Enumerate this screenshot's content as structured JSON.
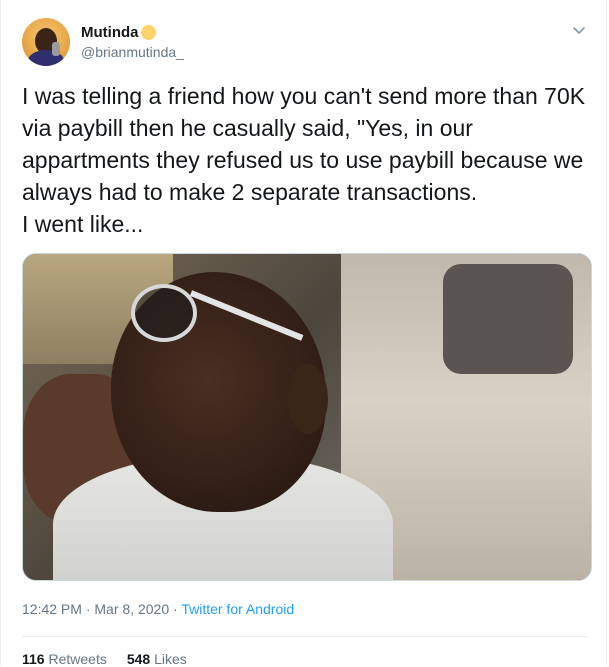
{
  "tweet": {
    "author": {
      "display_name": "Mutinda",
      "handle": "@brianmutinda_",
      "badge_icon": "sun-emoji-icon",
      "badge_color": "#ffd36b"
    },
    "menu_icon": "chevron-down-icon",
    "text": "I was telling a friend how you can't send more than 70K via paybill then he casually said, \"Yes, in our appartments they refused us to use paybill because we always had to make 2 separate transactions.\nI went like...",
    "meta": {
      "time": "12:42 PM",
      "separator_1": " · ",
      "date": "Mar 8, 2020",
      "separator_2": " · ",
      "source": "Twitter for Android"
    },
    "stats": {
      "retweets_count": "116",
      "retweets_label": "Retweets",
      "likes_count": "548",
      "likes_label": "Likes"
    }
  },
  "colors": {
    "link": "#1da1f2",
    "secondary_text": "#657786",
    "primary_text": "#14171a"
  }
}
